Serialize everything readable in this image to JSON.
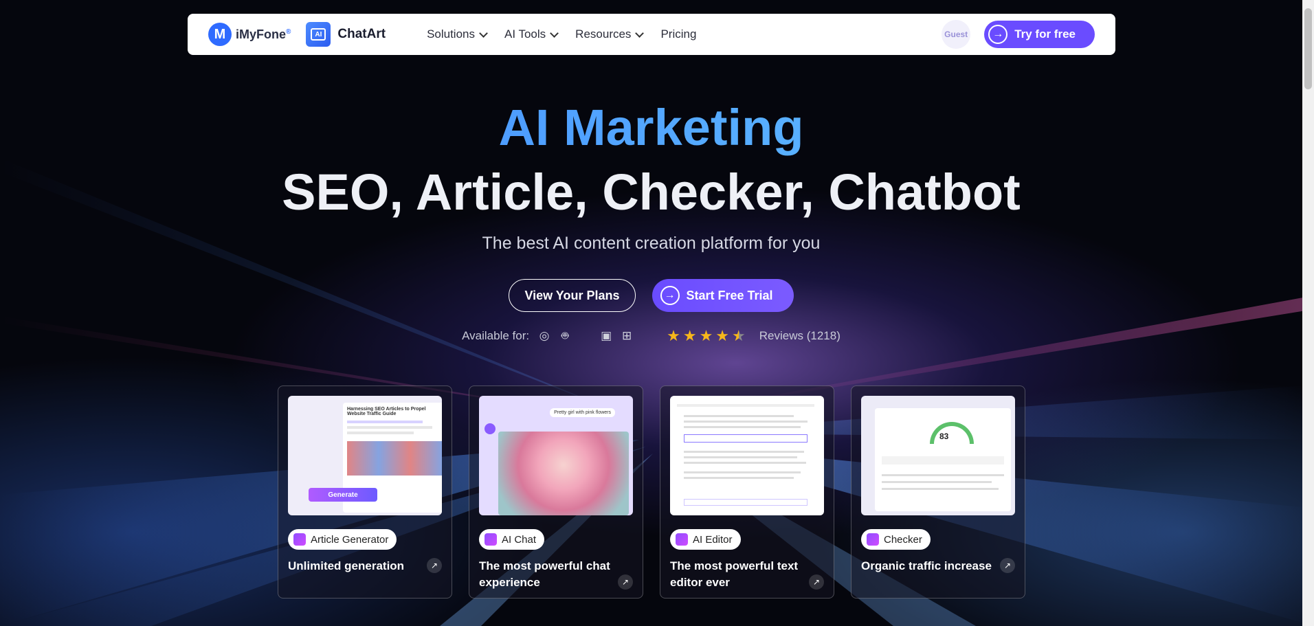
{
  "header": {
    "brand": "iMyFone",
    "brand_mark": "®",
    "product_logo_text": "AI",
    "product": "ChatArt",
    "menu": [
      {
        "label": "Solutions",
        "has_dropdown": true
      },
      {
        "label": "AI Tools",
        "has_dropdown": true
      },
      {
        "label": "Resources",
        "has_dropdown": true
      },
      {
        "label": "Pricing",
        "has_dropdown": false
      }
    ],
    "guest": "Guest",
    "try_button": "Try for free"
  },
  "hero": {
    "title": "AI Marketing",
    "subtitle": "SEO, Article, Checker, Chatbot",
    "tagline": "The best AI content creation platform for you",
    "view_plans": "View Your Plans",
    "start_trial": "Start Free Trial",
    "available_label": "Available for:",
    "platforms": [
      "chrome-icon",
      "android-icon",
      "apple-icon",
      "finder-icon",
      "windows-icon"
    ],
    "rating_stars": 4.5,
    "reviews": "Reviews (1218)"
  },
  "cards": [
    {
      "tag": "Article Generator",
      "title": "Unlimited generation",
      "thumb_heading": "Harnessing SEO Articles to Propel Website Traffic Guide",
      "thumb_button": "Generate"
    },
    {
      "tag": "AI Chat",
      "title": "The most powerful chat experience",
      "thumb_bubble": "Pretty girl with pink flowers"
    },
    {
      "tag": "AI Editor",
      "title": "The most powerful text editor ever"
    },
    {
      "tag": "Checker",
      "title": "Organic traffic increase",
      "thumb_score": "83"
    }
  ],
  "colors": {
    "accent": "#6a4cff",
    "title_gradient_start": "#3b7dff",
    "title_gradient_end": "#6bd0ff",
    "star": "#f6b71b"
  }
}
